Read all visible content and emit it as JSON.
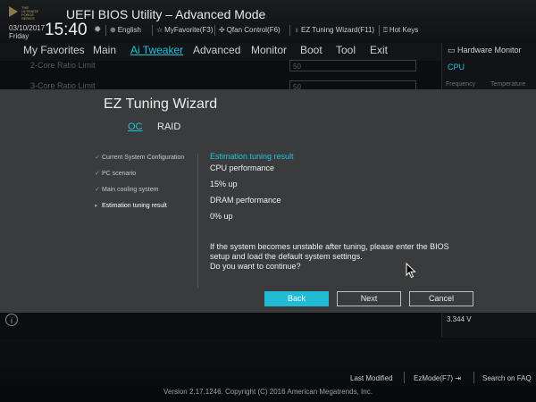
{
  "header": {
    "app_title": "UEFI BIOS Utility – Advanced Mode",
    "date": "03/10/2017",
    "day": "Friday",
    "time": "15:40",
    "logo_lines": [
      "THE",
      "ULTIMATE",
      "FORCE",
      "SERIES"
    ],
    "tools": [
      {
        "icon": "globe-icon",
        "label": "English"
      },
      {
        "icon": "star-icon",
        "label": "MyFavorite(F3)"
      },
      {
        "icon": "fan-icon",
        "label": "Qfan Control(F6)"
      },
      {
        "icon": "bulb-icon",
        "label": "EZ Tuning Wizard(F11)"
      },
      {
        "icon": "help-icon",
        "label": "Hot Keys"
      }
    ]
  },
  "menu": {
    "items": [
      "My Favorites",
      "Main",
      "Ai Tweaker",
      "Advanced",
      "Monitor",
      "Boot",
      "Tool",
      "Exit"
    ],
    "active": "Ai Tweaker"
  },
  "background_rows": [
    {
      "label": "2-Core Ratio Limit",
      "value": "50"
    },
    {
      "label": "3-Core Ratio Limit",
      "value": "50"
    }
  ],
  "hardware_monitor": {
    "title": "Hardware Monitor",
    "section": "CPU",
    "col1": "Frequency",
    "col2": "Temperature",
    "voltage": "3.344 V"
  },
  "wizard": {
    "title": "EZ Tuning Wizard",
    "tabs": [
      "OC",
      "RAID"
    ],
    "steps": [
      {
        "label": "Current System Configuration",
        "state": "done"
      },
      {
        "label": "PC scenario",
        "state": "done"
      },
      {
        "label": "Main cooling system",
        "state": "done"
      },
      {
        "label": "Estimation tuning result",
        "state": "current"
      }
    ],
    "result_heading": "Estimation tuning result",
    "cpu_label": "CPU performance",
    "cpu_value": "15% up",
    "dram_label": "DRAM performance",
    "dram_value": "0% up",
    "warning": "If the system becomes unstable after tuning, please enter the BIOS setup and load the default system settings.",
    "question": "Do you want to continue?",
    "buttons": {
      "back": "Back",
      "next": "Next",
      "cancel": "Cancel"
    }
  },
  "footer": {
    "last_modified": "Last Modified",
    "ezmode": "EzMode(F7)",
    "search": "Search on FAQ",
    "version": "Version 2.17.1246. Copyright (C) 2016 American Megatrends, Inc."
  },
  "colors": {
    "accent": "#21c3de",
    "dialog_bg": "#3a3b3d",
    "background": "#0b0d0f"
  }
}
